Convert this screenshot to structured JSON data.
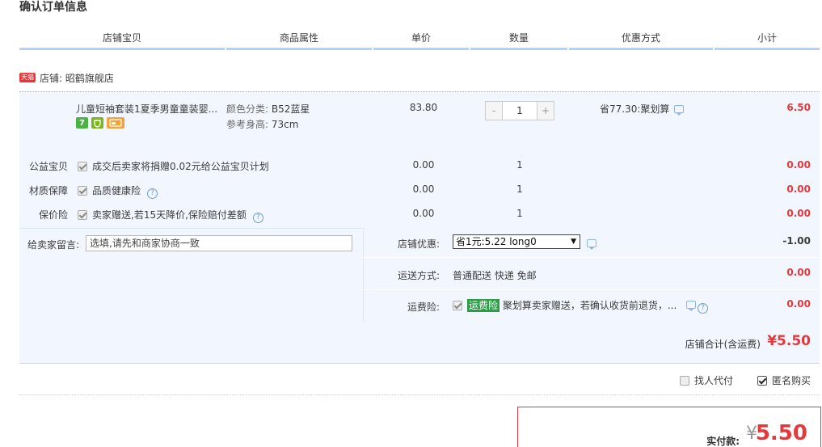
{
  "page": {
    "title": "确认订单信息"
  },
  "table_header": [
    "店铺宝贝",
    "商品属性",
    "单价",
    "数量",
    "优惠方式",
    "小计"
  ],
  "shop": {
    "badge": "天猫",
    "label": "店铺: 昭鹤旗舰店"
  },
  "item": {
    "title": "儿童短袖套装1夏季男童童装婴...",
    "badges": [
      "7",
      "",
      ""
    ],
    "prop1_label": "颜色分类:",
    "prop1_value": "B52蓝星",
    "prop2_label": "参考身高:",
    "prop2_value": "73cm",
    "price": "83.80",
    "qty_minus": "-",
    "qty": "1",
    "qty_plus": "+",
    "promo": "省77.30:聚划算",
    "subtotal": "6.50"
  },
  "services": [
    {
      "label": "公益宝贝",
      "text": "成交后卖家将捐赠0.02元给公益宝贝计划",
      "help": false,
      "price": "0.00",
      "qty": "1",
      "subtotal": "0.00"
    },
    {
      "label": "材质保障",
      "text": "品质健康险",
      "help": true,
      "price": "0.00",
      "qty": "1",
      "subtotal": "0.00"
    },
    {
      "label": "保价险",
      "text": "卖家赠送,若15天降价,保险赔付差额",
      "help": true,
      "price": "0.00",
      "qty": "1",
      "subtotal": "0.00"
    }
  ],
  "message": {
    "label": "给卖家留言:",
    "value": "选填,请先和商家协商一致"
  },
  "shop_discount": {
    "label": "店铺优惠:",
    "selected": "省1元:5.22 long0",
    "value": "-1.00"
  },
  "shipping": {
    "label": "运送方式:",
    "text": "普通配送 快递 免邮",
    "value": "0.00"
  },
  "insurance": {
    "label": "运费险:",
    "tag": "运费险",
    "text": "聚划算卖家赠送，若确认收货前退货，...",
    "value": "0.00"
  },
  "shop_total": {
    "label": "店铺合计(含运费)",
    "value": "¥5.50"
  },
  "options": {
    "proxy_pay": "找人代付",
    "anonymous": "匿名购买"
  },
  "payment": {
    "label": "实付款:",
    "currency": "¥",
    "value": "5.50"
  }
}
